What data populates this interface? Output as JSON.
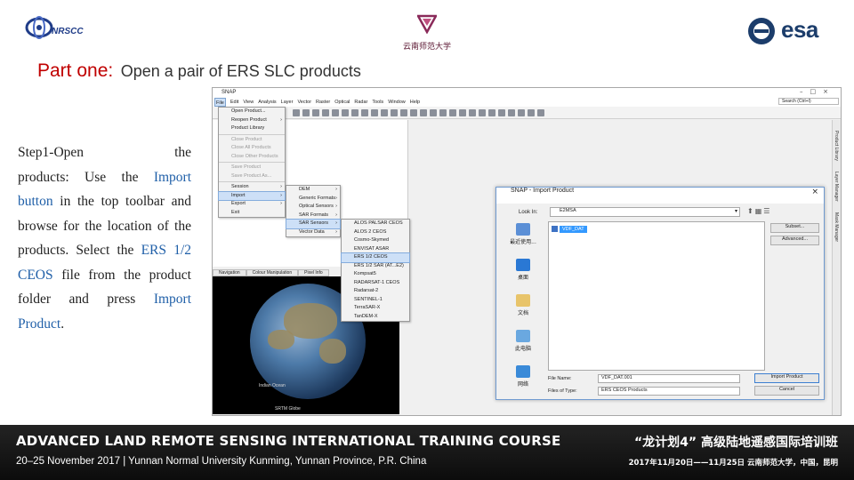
{
  "logos": {
    "nrscc": "NRSCC",
    "university": "云南师范大学",
    "esa": "esa"
  },
  "title": {
    "part": "Part one:",
    "subtitle": "Open a pair of ERS SLC products"
  },
  "description": {
    "step_a": "Step1-Open",
    "step_b": "the",
    "seg1": "products: Use the ",
    "import_hl": "Import",
    "button_hl": "button",
    "seg2": " in the top toolbar and browse for the location of the products. Select the ",
    "file_hl": "ERS 1/2 CEOS",
    "seg3": " file from the product folder and press ",
    "product_hl": "Import Product",
    "seg4": "."
  },
  "snap": {
    "window_title": "SNAP",
    "search_placeholder": "Search (Ctrl+I)",
    "menubar": [
      "File",
      "Edit",
      "View",
      "Analysis",
      "Layer",
      "Vector",
      "Raster",
      "Optical",
      "Radar",
      "Tools",
      "Window",
      "Help"
    ],
    "panel_tabs": [
      "Navigation",
      "Colour Manipulation",
      "Pixel Info"
    ],
    "sidebar_tabs": [
      "Product Library",
      "Layer Manager",
      "Mask Manager"
    ],
    "world_labels": {
      "ocean": "Indian Ocean",
      "bottom": "SRTM Globe"
    }
  },
  "file_menu": [
    {
      "label": "Open Product...",
      "disabled": false
    },
    {
      "label": "Reopen Product",
      "disabled": false,
      "submenu": true
    },
    {
      "label": "Product Library",
      "disabled": false
    },
    {
      "sep": true
    },
    {
      "label": "Close Product",
      "disabled": true
    },
    {
      "label": "Close All Products",
      "disabled": true
    },
    {
      "label": "Close Other Products",
      "disabled": true
    },
    {
      "sep": true
    },
    {
      "label": "Save Product",
      "disabled": true
    },
    {
      "label": "Save Product As...",
      "disabled": true
    },
    {
      "sep": true
    },
    {
      "label": "Session",
      "disabled": false,
      "submenu": true
    },
    {
      "label": "Import",
      "disabled": false,
      "submenu": true,
      "selected": true
    },
    {
      "label": "Export",
      "disabled": false,
      "submenu": true
    },
    {
      "label": "Exit",
      "disabled": false
    }
  ],
  "import_menu": [
    {
      "label": "DEM",
      "submenu": true
    },
    {
      "label": "Generic Formats",
      "submenu": true
    },
    {
      "label": "Optical Sensors",
      "submenu": true
    },
    {
      "label": "SAR Formats",
      "submenu": true
    },
    {
      "label": "SAR Sensors",
      "submenu": true,
      "selected": true
    },
    {
      "label": "Vector Data",
      "submenu": true
    }
  ],
  "sar_menu": [
    {
      "label": "ALOS PALSAR CEOS"
    },
    {
      "label": "ALOS 2 CEOS"
    },
    {
      "label": "Cosmo-Skymed"
    },
    {
      "label": "ENVISAT ASAR"
    },
    {
      "label": "ERS 1/2 CEOS",
      "selected": true
    },
    {
      "label": "ERS 1/2 SAR (AT...E2)"
    },
    {
      "label": "Kompsat5"
    },
    {
      "label": "RADARSAT-1 CEOS"
    },
    {
      "label": "Radarsat-2"
    },
    {
      "label": "SENTINEL-1"
    },
    {
      "label": "TerraSAR-X"
    },
    {
      "label": "TanDEM-X"
    }
  ],
  "dialog": {
    "title": "SNAP - Import Product",
    "look_in_label": "Look In:",
    "look_in_value": "E2MSA",
    "places": [
      "最近使用...",
      "桌面",
      "文档",
      "此电脑",
      "网络"
    ],
    "file_name": "VDF_DAT",
    "subset_button": "Subset...",
    "advanced_option": "Advanced...",
    "file_name_label": "File Name:",
    "file_name_value": "VDF_DAT.001",
    "file_type_label": "Files of Type:",
    "file_type_value": "ERS CEOS Products",
    "import_button": "Import Product",
    "cancel_button": "Cancel"
  },
  "footer": {
    "course": "ADVANCED LAND REMOTE SENSING INTERNATIONAL TRAINING COURSE",
    "date_location": "20–25 November 2017 | Yunnan Normal University Kunming, Yunnan Province, P.R. China",
    "course_cn": "“龙计划4” 高级陆地遥感国际培训班",
    "date_cn": "2017年11月20日——11月25日   云南师范大学，中国，昆明"
  },
  "colors": {
    "title_red": "#c00000",
    "highlight_blue": "#1f5fa8",
    "footer_bg": "#151515",
    "menu_selected": "#cde0f7"
  }
}
